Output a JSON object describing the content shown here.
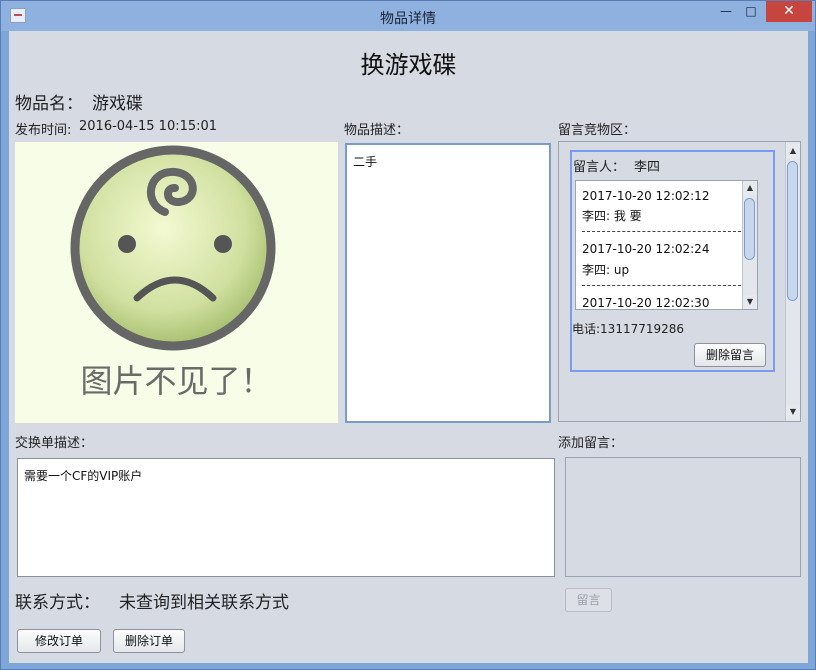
{
  "window": {
    "title": "物品详情",
    "min": "—",
    "max": "□",
    "close": "✕"
  },
  "header": {
    "title": "换游戏碟"
  },
  "item": {
    "name_label": "物品名：",
    "name_value": "游戏碟",
    "publish_label": "发布时间:",
    "publish_value": "2016-04-15 10:15:01",
    "image_text": "图片不见了！",
    "desc_label": "物品描述：",
    "desc_value": "二手"
  },
  "comments": {
    "section_label": "留言竞物区：",
    "author_label": "留言人：",
    "author_value": "李四",
    "messages": [
      {
        "time": "2017-10-20 12:02:12",
        "text": "李四: 我 要"
      },
      {
        "time": "2017-10-20 12:02:24",
        "text": "李四: up"
      },
      {
        "time": "2017-10-20 12:02:30"
      }
    ],
    "phone": "电话:13117719286",
    "delete_button": "删除留言"
  },
  "exchange": {
    "label": "交换单描述：",
    "value": "需要一个CF的VIP账户"
  },
  "add_comment": {
    "label": "添加留言：",
    "submit_button": "留言"
  },
  "contact": {
    "label": "联系方式：",
    "value": "未查询到相关联系方式"
  },
  "actions": {
    "modify_button": "修改订单",
    "delete_button": "删除订单"
  },
  "colors": {
    "close_button": "#c7453f",
    "client_bg": "#d6dae3",
    "title_bg": "#8eb1e0"
  }
}
